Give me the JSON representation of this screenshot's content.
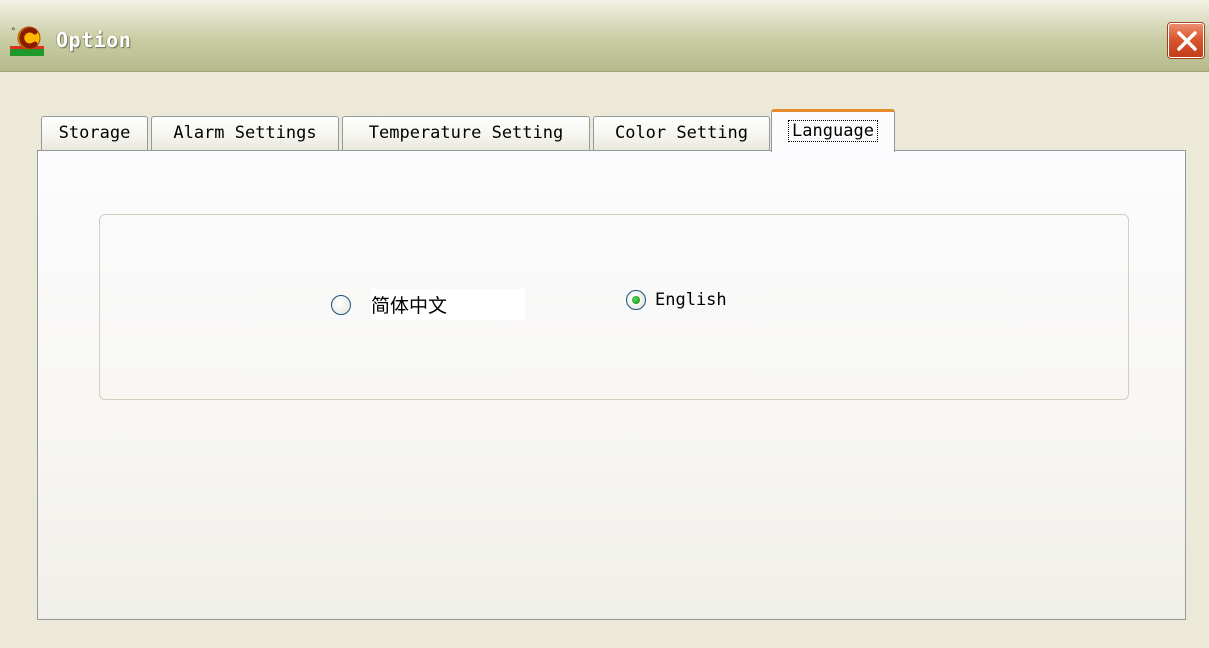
{
  "window": {
    "title": "Option",
    "app_icon": "app-logo-icon",
    "close_icon": "close-icon"
  },
  "tabs": [
    {
      "label": "Storage",
      "active": false
    },
    {
      "label": "Alarm Settings",
      "active": false
    },
    {
      "label": "Temperature Setting",
      "active": false
    },
    {
      "label": "Color Setting",
      "active": false
    },
    {
      "label": "Language",
      "active": true
    }
  ],
  "language": {
    "options": [
      {
        "label": "简体中文",
        "checked": false
      },
      {
        "label": "English",
        "checked": true
      }
    ]
  },
  "colors": {
    "active_tab_accent": "#e68b2c",
    "radio_checked": "#21a121",
    "close_button": "#d9572f"
  }
}
